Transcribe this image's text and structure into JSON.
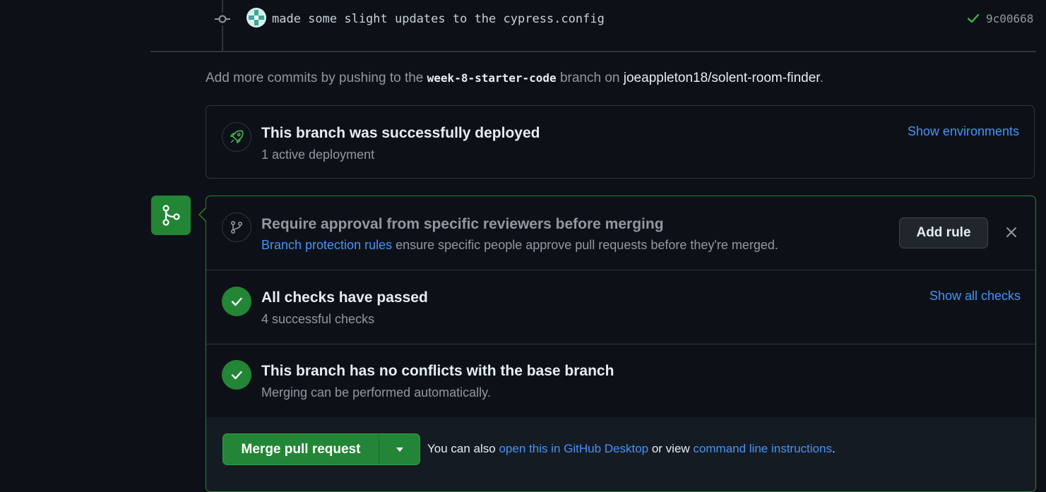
{
  "commit": {
    "message": "made some slight updates to the cypress.config",
    "sha": "9c00668"
  },
  "hint": {
    "prefix": "Add more commits by pushing to the ",
    "branch": "week-8-starter-code",
    "middle": " branch on ",
    "repo": "joeappleton18/solent-room-finder",
    "suffix": "."
  },
  "deployment": {
    "title": "This branch was successfully deployed",
    "subtitle": "1 active deployment",
    "link": "Show environments"
  },
  "reviewers": {
    "title": "Require approval from specific reviewers before merging",
    "link": "Branch protection rules",
    "text": " ensure specific people approve pull requests before they're merged.",
    "button": "Add rule"
  },
  "checks": {
    "title": "All checks have passed",
    "subtitle": "4 successful checks",
    "link": "Show all checks"
  },
  "conflicts": {
    "title": "This branch has no conflicts with the base branch",
    "subtitle": "Merging can be performed automatically."
  },
  "merge": {
    "button": "Merge pull request",
    "also_prefix": "You can also ",
    "desktop_link": "open this in GitHub Desktop",
    "or_view": " or view ",
    "cli_link": "command line instructions",
    "suffix": "."
  },
  "colors": {
    "success": "#238636",
    "link": "#4493f8",
    "background": "#0d1117"
  },
  "icons": [
    "commit-icon",
    "check-icon",
    "rocket-icon",
    "git-merge-icon",
    "git-branch-icon",
    "close-icon",
    "triangle-down-icon"
  ]
}
